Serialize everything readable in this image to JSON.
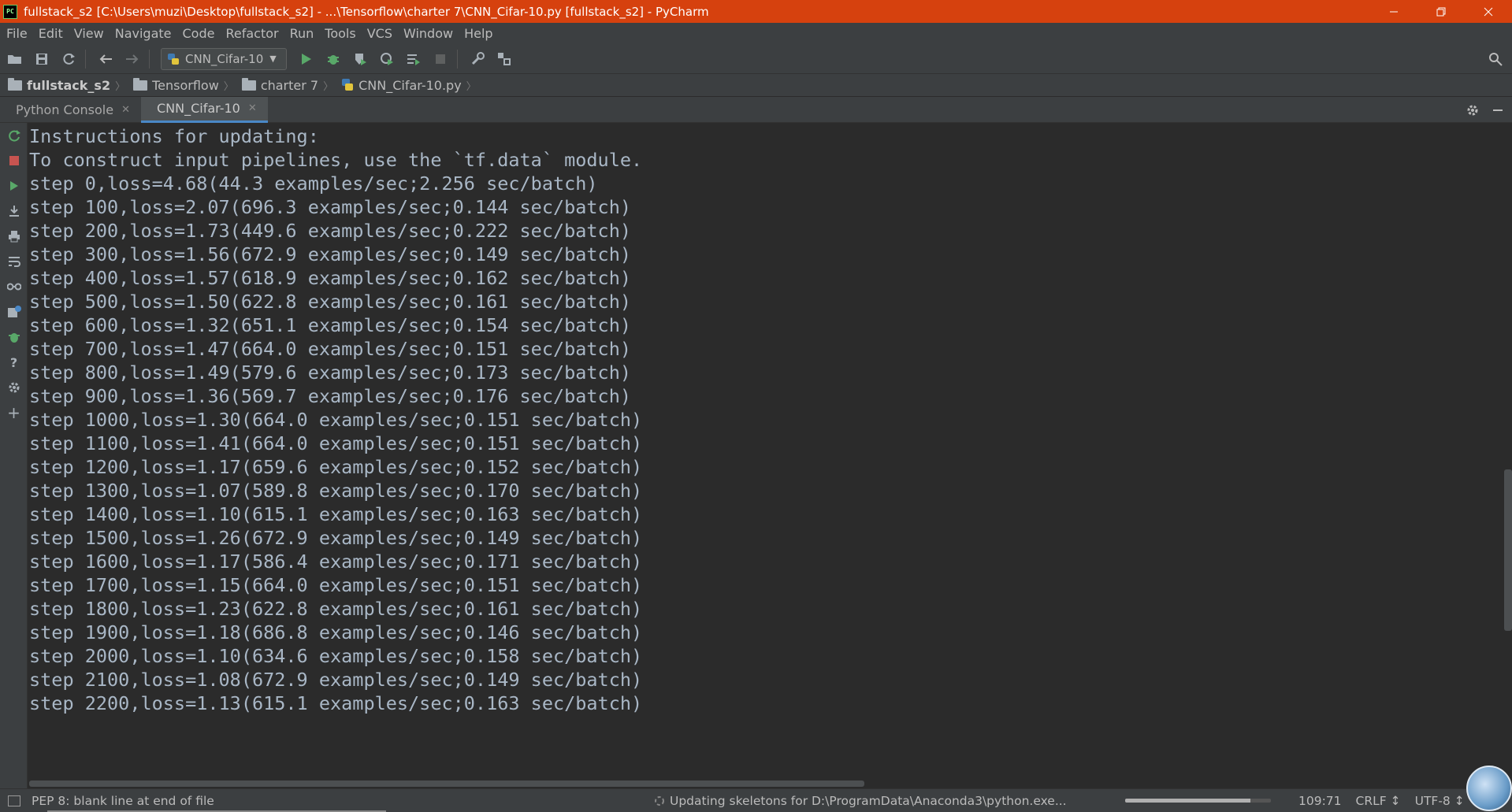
{
  "window": {
    "app_icon": "PC",
    "title": "fullstack_s2 [C:\\Users\\muzi\\Desktop\\fullstack_s2] - ...\\Tensorflow\\charter 7\\CNN_Cifar-10.py [fullstack_s2] - PyCharm",
    "controls": [
      "minimize-icon",
      "restore-icon",
      "close-icon"
    ]
  },
  "menu": {
    "items": [
      "File",
      "Edit",
      "View",
      "Navigate",
      "Code",
      "Refactor",
      "Run",
      "Tools",
      "VCS",
      "Window",
      "Help"
    ]
  },
  "toolbar": {
    "run_config": "CNN_Cifar-10"
  },
  "breadcrumb": {
    "items": [
      "fullstack_s2",
      "Tensorflow",
      "charter 7",
      "CNN_Cifar-10.py"
    ]
  },
  "tabs": [
    {
      "label": "Python Console",
      "active": false
    },
    {
      "label": "CNN_Cifar-10",
      "active": true
    }
  ],
  "console": {
    "lines": [
      "Instructions for updating:",
      "To construct input pipelines, use the `tf.data` module.",
      "step 0,loss=4.68(44.3 examples/sec;2.256 sec/batch)",
      "step 100,loss=2.07(696.3 examples/sec;0.144 sec/batch)",
      "step 200,loss=1.73(449.6 examples/sec;0.222 sec/batch)",
      "step 300,loss=1.56(672.9 examples/sec;0.149 sec/batch)",
      "step 400,loss=1.57(618.9 examples/sec;0.162 sec/batch)",
      "step 500,loss=1.50(622.8 examples/sec;0.161 sec/batch)",
      "step 600,loss=1.32(651.1 examples/sec;0.154 sec/batch)",
      "step 700,loss=1.47(664.0 examples/sec;0.151 sec/batch)",
      "step 800,loss=1.49(579.6 examples/sec;0.173 sec/batch)",
      "step 900,loss=1.36(569.7 examples/sec;0.176 sec/batch)",
      "step 1000,loss=1.30(664.0 examples/sec;0.151 sec/batch)",
      "step 1100,loss=1.41(664.0 examples/sec;0.151 sec/batch)",
      "step 1200,loss=1.17(659.6 examples/sec;0.152 sec/batch)",
      "step 1300,loss=1.07(589.8 examples/sec;0.170 sec/batch)",
      "step 1400,loss=1.10(615.1 examples/sec;0.163 sec/batch)",
      "step 1500,loss=1.26(672.9 examples/sec;0.149 sec/batch)",
      "step 1600,loss=1.17(586.4 examples/sec;0.171 sec/batch)",
      "step 1700,loss=1.15(664.0 examples/sec;0.151 sec/batch)",
      "step 1800,loss=1.23(622.8 examples/sec;0.161 sec/batch)",
      "step 1900,loss=1.18(686.8 examples/sec;0.146 sec/batch)",
      "step 2000,loss=1.10(634.6 examples/sec;0.158 sec/batch)",
      "step 2100,loss=1.08(672.9 examples/sec;0.149 sec/batch)",
      "step 2200,loss=1.13(615.1 examples/sec;0.163 sec/batch)"
    ]
  },
  "status": {
    "message": "PEP 8: blank line at end of file",
    "progress_text": "Updating skeletons for D:\\ProgramData\\Anaconda3\\python.exe...",
    "progress_fraction": 0.86,
    "position": "109:71",
    "line_sep": "CRLF ↕",
    "encoding": "UTF-8 ↕"
  },
  "colors": {
    "titlebar": "#d6410e",
    "chrome": "#3c3f41",
    "console_bg": "#2b2b2b",
    "console_text": "#a9b7c6",
    "run_green": "#59a869",
    "stop_red": "#c75450"
  }
}
